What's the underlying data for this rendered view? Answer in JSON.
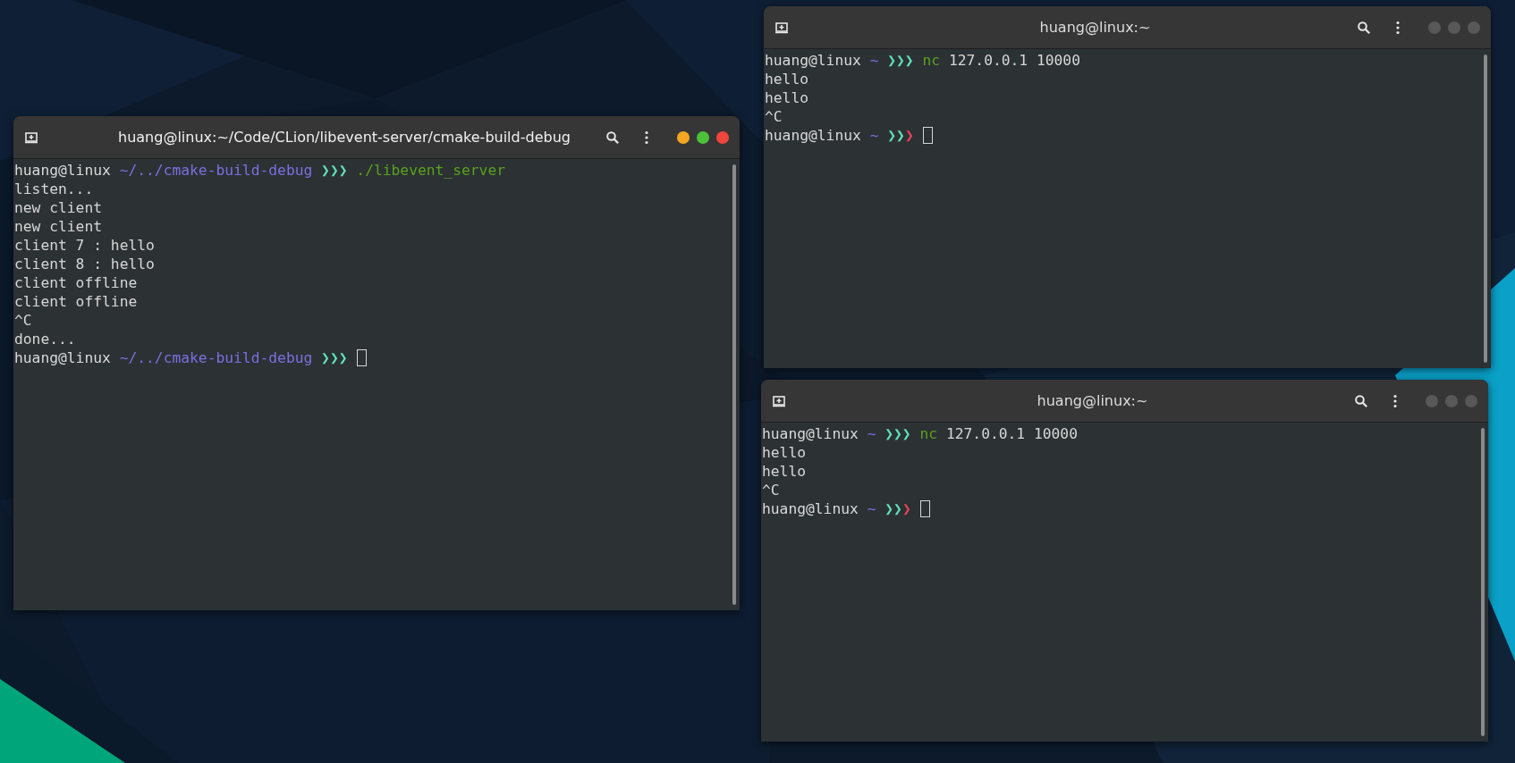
{
  "desktop": {
    "windows": [
      {
        "title": "huang@linux:~/Code/CLion/libevent-server/cmake-build-debug",
        "active": true,
        "lines": [
          {
            "segments": [
              {
                "kind": "user",
                "text": "huang@linux"
              },
              {
                "kind": "path",
                "text": "~/../cmake-build-debug"
              },
              {
                "kind": "prompt",
                "text": "❯❯❯"
              },
              {
                "kind": "command",
                "text": "./libevent_server"
              }
            ],
            "cursor": false
          },
          {
            "segments": [
              {
                "kind": "output",
                "text": "listen..."
              }
            ],
            "cursor": false
          },
          {
            "segments": [
              {
                "kind": "output",
                "text": "new client"
              }
            ],
            "cursor": false
          },
          {
            "segments": [
              {
                "kind": "output",
                "text": "new client"
              }
            ],
            "cursor": false
          },
          {
            "segments": [
              {
                "kind": "output",
                "text": "client 7 : hello"
              }
            ],
            "cursor": false
          },
          {
            "segments": [
              {
                "kind": "output",
                "text": "client 8 : hello"
              }
            ],
            "cursor": false
          },
          {
            "segments": [
              {
                "kind": "output",
                "text": "client offline"
              }
            ],
            "cursor": false
          },
          {
            "segments": [
              {
                "kind": "output",
                "text": "client offline"
              }
            ],
            "cursor": false
          },
          {
            "segments": [
              {
                "kind": "output",
                "text": "^C"
              }
            ],
            "cursor": false
          },
          {
            "segments": [
              {
                "kind": "output",
                "text": "done..."
              }
            ],
            "cursor": false
          },
          {
            "segments": [
              {
                "kind": "user",
                "text": "huang@linux"
              },
              {
                "kind": "path",
                "text": "~/../cmake-build-debug"
              },
              {
                "kind": "prompt",
                "text": "❯❯❯"
              }
            ],
            "cursor": true
          }
        ]
      },
      {
        "title": "huang@linux:~",
        "active": false,
        "lines": [
          {
            "segments": [
              {
                "kind": "user",
                "text": "huang@linux"
              },
              {
                "kind": "path",
                "text": "~"
              },
              {
                "kind": "prompt",
                "text": "❯❯❯"
              },
              {
                "kind": "command",
                "text": "nc"
              },
              {
                "kind": "output",
                "text": "127.0.0.1 10000"
              }
            ],
            "cursor": false
          },
          {
            "segments": [
              {
                "kind": "output",
                "text": "hello"
              }
            ],
            "cursor": false
          },
          {
            "segments": [
              {
                "kind": "output",
                "text": "hello"
              }
            ],
            "cursor": false
          },
          {
            "segments": [
              {
                "kind": "output",
                "text": "^C"
              }
            ],
            "cursor": false
          },
          {
            "segments": [
              {
                "kind": "user",
                "text": "huang@linux"
              },
              {
                "kind": "path",
                "text": "~"
              },
              {
                "kind": "prompt",
                "text": "❯❯"
              },
              {
                "kind": "prompt-error",
                "text": "❯"
              }
            ],
            "cursor": true
          }
        ]
      },
      {
        "title": "huang@linux:~",
        "active": false,
        "lines": [
          {
            "segments": [
              {
                "kind": "user",
                "text": "huang@linux"
              },
              {
                "kind": "path",
                "text": "~"
              },
              {
                "kind": "prompt",
                "text": "❯❯❯"
              },
              {
                "kind": "command",
                "text": "nc"
              },
              {
                "kind": "output",
                "text": "127.0.0.1 10000"
              }
            ],
            "cursor": false
          },
          {
            "segments": [
              {
                "kind": "output",
                "text": "hello"
              }
            ],
            "cursor": false
          },
          {
            "segments": [
              {
                "kind": "output",
                "text": "hello"
              }
            ],
            "cursor": false
          },
          {
            "segments": [
              {
                "kind": "output",
                "text": "^C"
              }
            ],
            "cursor": false
          },
          {
            "segments": [
              {
                "kind": "user",
                "text": "huang@linux"
              },
              {
                "kind": "path",
                "text": "~"
              },
              {
                "kind": "prompt",
                "text": "❯❯"
              },
              {
                "kind": "prompt-error",
                "text": "❯"
              }
            ],
            "cursor": true
          }
        ]
      }
    ]
  }
}
